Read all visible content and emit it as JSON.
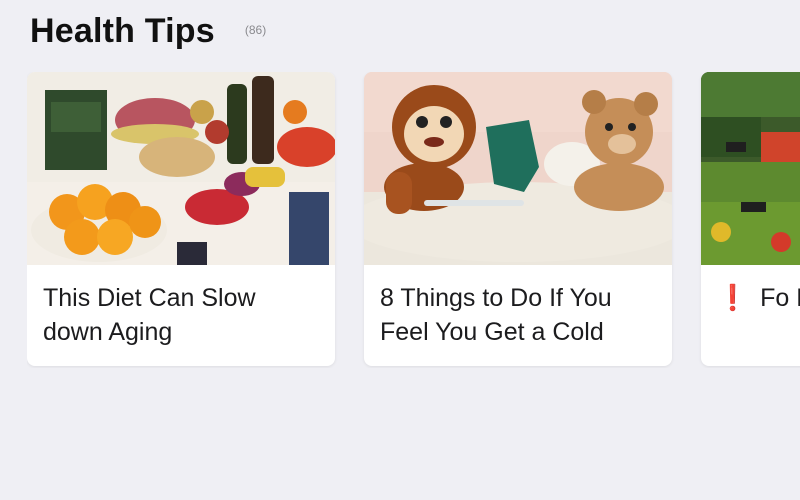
{
  "section": {
    "title": "Health Tips",
    "count": "(86)"
  },
  "cards": [
    {
      "title": "This Diet Can Slow down Aging",
      "image_icon": "fruit-spread-photo"
    },
    {
      "title": "8 Things to Do If You Feel You Get a Cold",
      "image_icon": "sick-plush-toys-photo"
    },
    {
      "title_marker": "❗",
      "title": "Fo Nutriti",
      "image_icon": "vegetable-market-photo"
    }
  ],
  "colors": {
    "background": "#efeff4",
    "card": "#ffffff",
    "title_text": "#111111",
    "marker": "#d22b1f"
  }
}
